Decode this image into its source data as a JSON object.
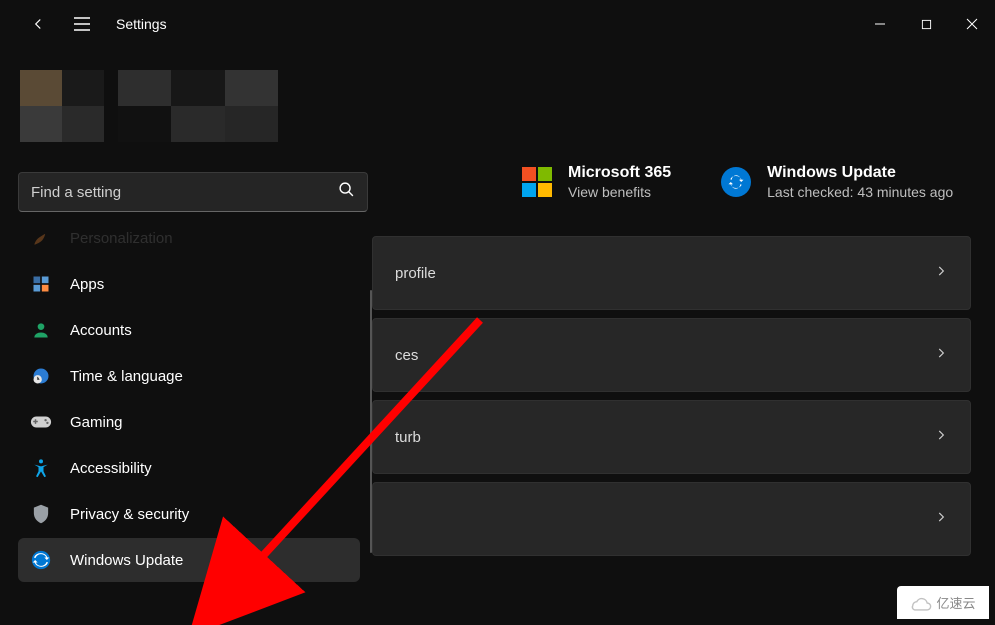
{
  "titlebar": {
    "title": "Settings"
  },
  "search": {
    "placeholder": "Find a setting"
  },
  "sidebar": {
    "items": [
      {
        "label": "Personalization"
      },
      {
        "label": "Apps"
      },
      {
        "label": "Accounts"
      },
      {
        "label": "Time & language"
      },
      {
        "label": "Gaming"
      },
      {
        "label": "Accessibility"
      },
      {
        "label": "Privacy & security"
      },
      {
        "label": "Windows Update"
      }
    ]
  },
  "hero": {
    "microsoft365": {
      "title": "Microsoft 365",
      "subtitle": "View benefits"
    },
    "windows_update": {
      "title": "Windows Update",
      "subtitle": "Last checked: 43 minutes ago"
    }
  },
  "cards": [
    {
      "label": "profile"
    },
    {
      "label": "ces"
    },
    {
      "label": "turb"
    },
    {
      "label": ""
    }
  ],
  "watermark": {
    "text": "亿速云"
  }
}
